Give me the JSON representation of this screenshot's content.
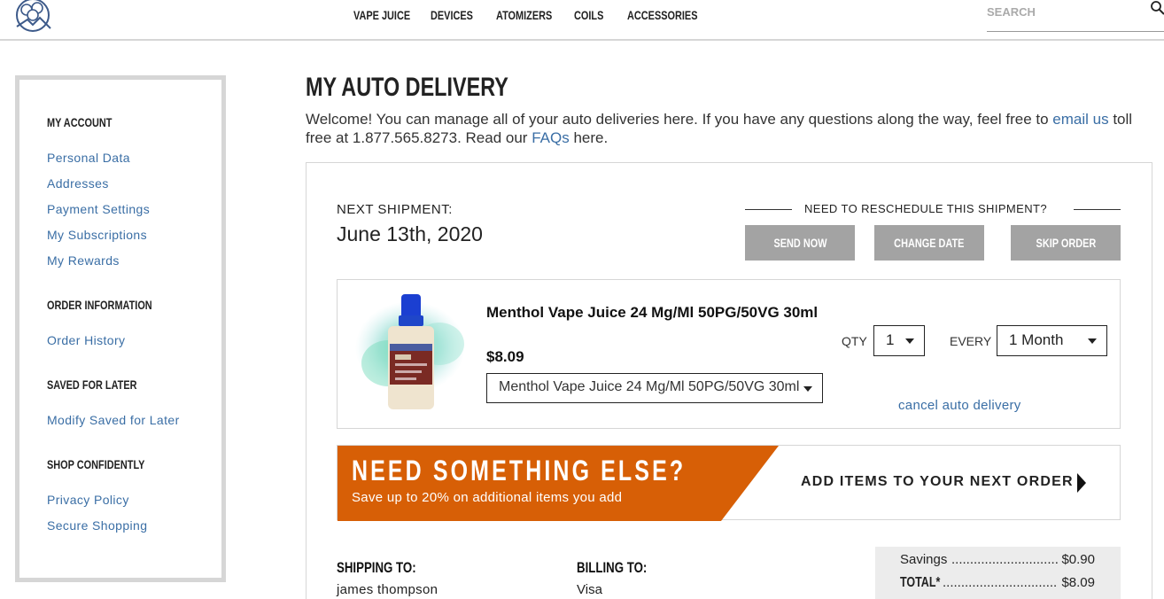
{
  "header": {
    "nav": [
      "VAPE JUICE",
      "DEVICES",
      "ATOMIZERS",
      "COILS",
      "ACCESSORIES"
    ],
    "search_placeholder": "SEARCH"
  },
  "sidebar": {
    "sections": [
      {
        "heading": "MY ACCOUNT",
        "links": [
          "Personal Data",
          "Addresses",
          "Payment Settings",
          "My Subscriptions",
          "My Rewards"
        ]
      },
      {
        "heading": "ORDER INFORMATION",
        "links": [
          "Order History"
        ]
      },
      {
        "heading": "SAVED FOR LATER",
        "links": [
          "Modify Saved for Later"
        ]
      },
      {
        "heading": "SHOP CONFIDENTLY",
        "links": [
          "Privacy Policy",
          "Secure Shopping"
        ]
      }
    ]
  },
  "main": {
    "title": "MY AUTO DELIVERY",
    "welcome": {
      "part1": "Welcome! You can manage all of your auto deliveries here. If you have any questions along the way, feel free to ",
      "email_link": "email us",
      "part2": " toll free at 1.877.565.8273. Read our ",
      "faq_link": "FAQs",
      "part3": " here."
    },
    "shipment": {
      "label": "NEXT SHIPMENT:",
      "date": "June 13th, 2020",
      "reschedule_text": "NEED TO RESCHEDULE THIS SHIPMENT?",
      "buttons": {
        "send_now": "SEND NOW",
        "change_date": "CHANGE DATE",
        "skip_order": "SKIP ORDER"
      }
    },
    "item": {
      "name": "Menthol Vape Juice 24 Mg/Ml 50PG/50VG 30ml",
      "price": "$8.09",
      "variant": "Menthol Vape Juice 24 Mg/Ml 50PG/50VG 30ml",
      "qty_label": "QTY",
      "qty": "1",
      "every_label": "EVERY",
      "every": "1 Month",
      "cancel": "cancel auto delivery"
    },
    "promo": {
      "title": "NEED SOMETHING ELSE?",
      "subtitle": "Save up to 20% on additional items you add",
      "cta": "ADD ITEMS TO YOUR NEXT ORDER"
    },
    "shipping": {
      "heading": "SHIPPING TO:",
      "name": "james thompson"
    },
    "billing": {
      "heading": "BILLING TO:",
      "method": "Visa"
    },
    "totals": {
      "savings_label": "Savings",
      "savings_dots": "..............................",
      "savings": "$0.90",
      "total_label": "TOTAL*",
      "total_dots": "...............................",
      "total": "$8.09"
    }
  },
  "colors": {
    "accent": "#d75f06",
    "link": "#3a6ea5",
    "button": "#a3a3a3",
    "border": "#d6d6d6"
  }
}
